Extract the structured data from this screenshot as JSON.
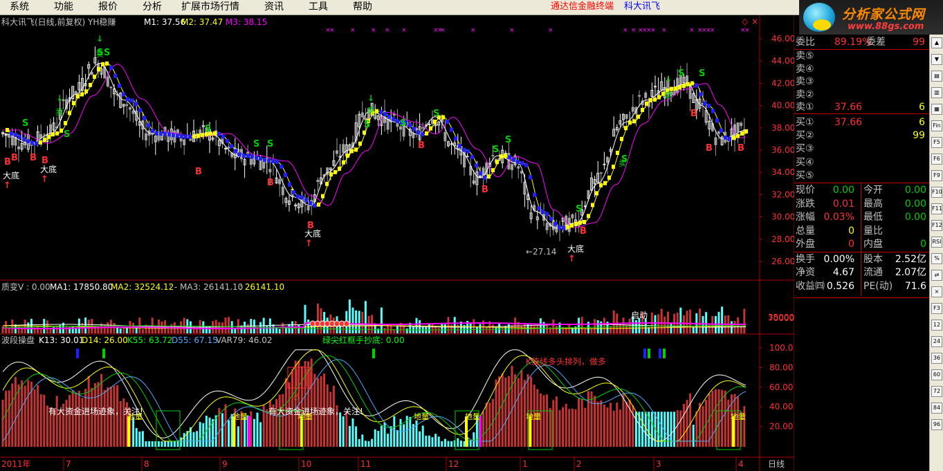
{
  "menu": {
    "items": [
      "系统",
      "功能",
      "报价",
      "分析",
      "扩展市场行情",
      "资讯",
      "工具",
      "帮助"
    ],
    "brand": "通达信金融终端",
    "brand2": "科大讯飞"
  },
  "logo": {
    "title": "分析家公式网",
    "url": "www.88gs.com"
  },
  "chart": {
    "header": {
      "title": "科大讯飞(日线,前复权) YH稳赚",
      "m1": "M1: 37.56",
      "m2": "M2: 37.47",
      "m3": "M3: 38.15"
    },
    "price_axis": [
      "46.00",
      "44.00",
      "42.00",
      "40.00",
      "38.00",
      "36.00",
      "34.00",
      "32.00",
      "30.00",
      "28.00",
      "26.00"
    ],
    "annotations": {
      "bottom1": "大底",
      "bottom2": "大底",
      "bottom3": "大底",
      "bottom4": "大底",
      "low_label": "←27.14",
      "buy_letter": "B",
      "sell_letter": "S",
      "sell_word": "卖"
    },
    "vol_header": {
      "a": "质变V : 0.00",
      "b": "MA1: 17850.80",
      "c": "MA2: 32524.12",
      "d": ": - MA3: 26141.10",
      "e": ": 26141.10"
    },
    "vol_axis": [
      "70000",
      "35000"
    ],
    "vol_text": "启动",
    "osc_header": {
      "a": "波段操盘",
      "b": "K13: 30.01",
      "c": "D14: 26.00",
      "d": "K55: 63.72",
      "e": "D55: 67.15",
      "f": "VAR79: 46.02",
      "g": "绿尖红框手抄底: 0.00"
    },
    "osc_axis": [
      "100.0",
      "80.00",
      "60.00",
      "40.00",
      "20.00"
    ],
    "osc_notes": {
      "n1": "有大资金进场迹象，关注!",
      "n2": "有大资金进场迹象，关注!",
      "n3": "K值线多头排列，做多",
      "lq": "地量"
    },
    "x_axis": {
      "year": "2011年",
      "months": [
        "7",
        "8",
        "9",
        "10",
        "11",
        "12",
        "1",
        "2",
        "3",
        "4"
      ],
      "period": "日线"
    }
  },
  "quote": {
    "weibi_label": "委比",
    "weibi": "89.19%",
    "weicha_label": "委差",
    "weicha": "99",
    "sell": [
      {
        "label": "卖⑤",
        "price": "",
        "vol": ""
      },
      {
        "label": "卖④",
        "price": "",
        "vol": ""
      },
      {
        "label": "卖③",
        "price": "",
        "vol": ""
      },
      {
        "label": "卖②",
        "price": "",
        "vol": ""
      },
      {
        "label": "卖①",
        "price": "37.66",
        "vol": "6"
      }
    ],
    "buy": [
      {
        "label": "买①",
        "price": "37.66",
        "vol": "6"
      },
      {
        "label": "买②",
        "price": "",
        "vol": "99"
      },
      {
        "label": "买③",
        "price": "",
        "vol": ""
      },
      {
        "label": "买④",
        "price": "",
        "vol": ""
      },
      {
        "label": "买⑤",
        "price": "",
        "vol": ""
      }
    ],
    "stats": [
      {
        "l1": "现价",
        "v1": "0.00",
        "l2": "今开",
        "v2": "0.00"
      },
      {
        "l1": "涨跌",
        "v1": "0.01",
        "l2": "最高",
        "v2": "0.00"
      },
      {
        "l1": "涨幅",
        "v1": "0.03%",
        "l2": "最低",
        "v2": "0.00"
      },
      {
        "l1": "总量",
        "v1": "0",
        "l2": "量比",
        "v2": ""
      },
      {
        "l1": "外盘",
        "v1": "0",
        "l2": "内盘",
        "v2": "0"
      },
      {
        "l1": "换手",
        "v1": "0.00%",
        "l2": "股本",
        "v2": "2.52亿"
      },
      {
        "l1": "净资",
        "v1": "4.67",
        "l2": "流通",
        "v2": "2.07亿"
      },
      {
        "l1": "收益㈣",
        "v1": "0.526",
        "l2": "PE(动)",
        "v2": "71.6"
      }
    ]
  },
  "toolbar": [
    "▲",
    "▼",
    "▤",
    "▥",
    "▦",
    "Fin",
    "F5",
    "F6",
    "F9",
    "F10",
    "F11",
    "F12",
    "RSI",
    "%",
    "⇄",
    "×",
    "F3",
    "12",
    "24",
    "36",
    "60",
    "72",
    "84",
    "96"
  ],
  "colors": {
    "bg": "#000000",
    "red": "#ff3030",
    "green": "#00d000",
    "cyan": "#54ffff",
    "yellow": "#ffff00",
    "blue": "#2020ff",
    "magenta": "#ff00ff",
    "up": "#c83434",
    "down": "#54ffff"
  }
}
